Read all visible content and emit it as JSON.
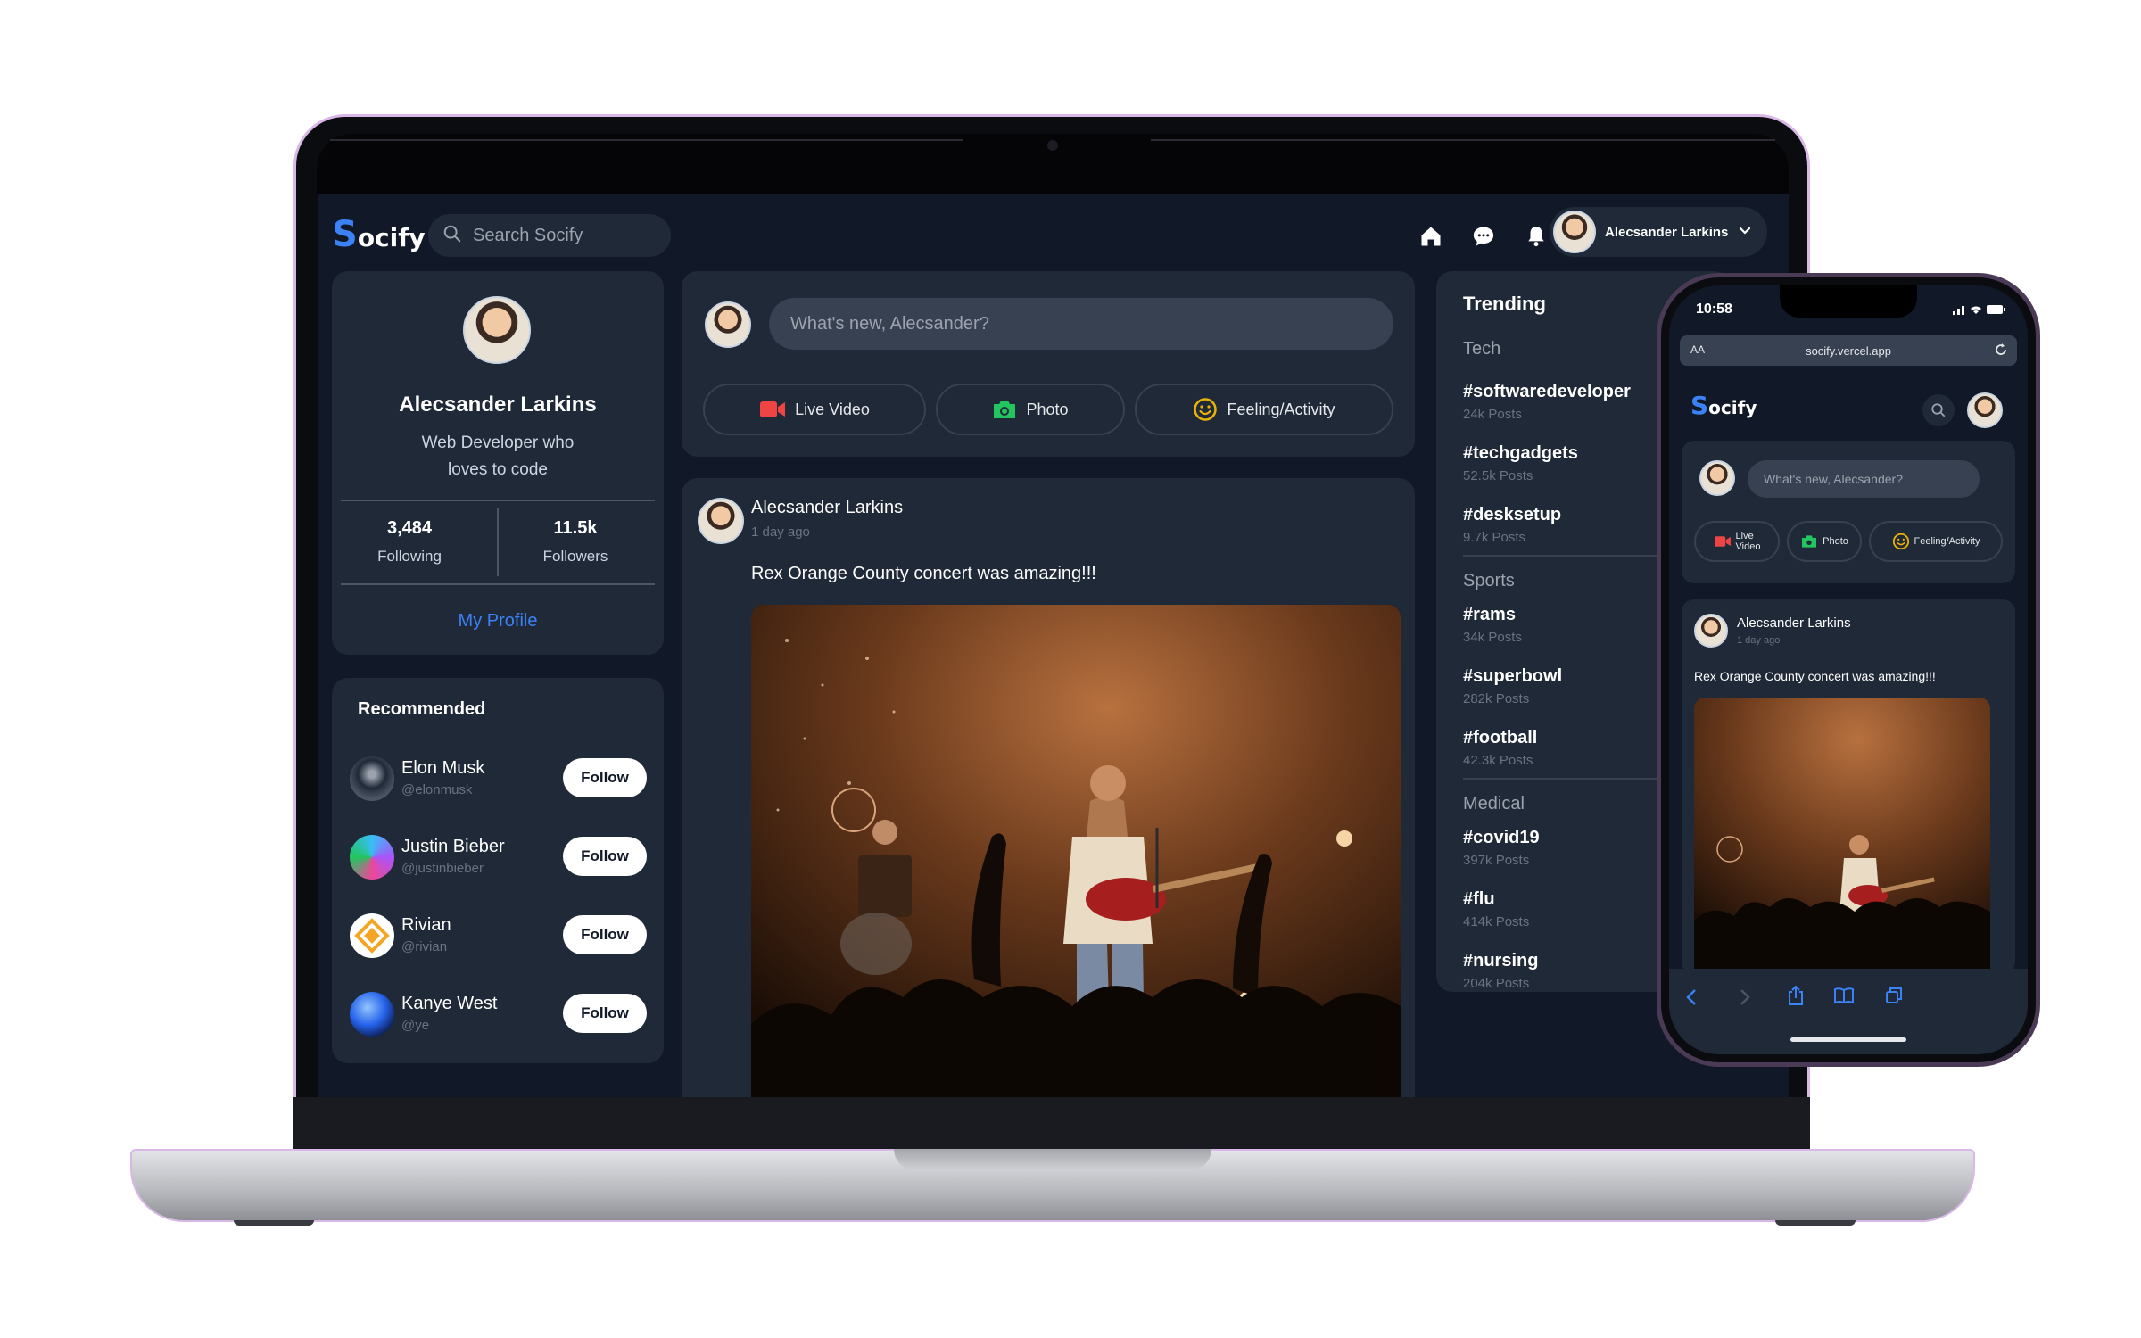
{
  "app": {
    "logo_initial": "S",
    "logo_rest": "ocify",
    "search_placeholder": "Search Socify",
    "user_name": "Alecsander Larkins"
  },
  "profile": {
    "name": "Alecsander Larkins",
    "bio_line1": "Web Developer who",
    "bio_line2": "loves to code",
    "following_count": "3,484",
    "following_label": "Following",
    "followers_count": "11.5k",
    "followers_label": "Followers",
    "my_profile_label": "My Profile"
  },
  "recommended": {
    "title": "Recommended",
    "follow_label": "Follow",
    "items": [
      {
        "name": "Elon Musk",
        "handle": "@elonmusk"
      },
      {
        "name": "Justin Bieber",
        "handle": "@justinbieber"
      },
      {
        "name": "Rivian",
        "handle": "@rivian"
      },
      {
        "name": "Kanye West",
        "handle": "@ye"
      }
    ]
  },
  "composer": {
    "placeholder": "What's new, Alecsander?",
    "live_video_label": "Live Video",
    "photo_label": "Photo",
    "feeling_label": "Feeling/Activity"
  },
  "post": {
    "author": "Alecsander Larkins",
    "time": "1 day ago",
    "text": "Rex Orange County concert was amazing!!!"
  },
  "trending": {
    "title": "Trending",
    "categories": [
      {
        "name": "Tech",
        "tags": [
          {
            "tag": "#softwaredeveloper",
            "posts": "24k Posts"
          },
          {
            "tag": "#techgadgets",
            "posts": "52.5k Posts"
          },
          {
            "tag": "#desksetup",
            "posts": "9.7k Posts"
          }
        ]
      },
      {
        "name": "Sports",
        "tags": [
          {
            "tag": "#rams",
            "posts": "34k Posts"
          },
          {
            "tag": "#superbowl",
            "posts": "282k Posts"
          },
          {
            "tag": "#football",
            "posts": "42.3k Posts"
          }
        ]
      },
      {
        "name": "Medical",
        "tags": [
          {
            "tag": "#covid19",
            "posts": "397k Posts"
          },
          {
            "tag": "#flu",
            "posts": "414k Posts"
          },
          {
            "tag": "#nursing",
            "posts": "204k Posts"
          }
        ]
      }
    ]
  },
  "phone": {
    "status_time": "10:58",
    "text_size_label": "AA",
    "url": "socify.vercel.app",
    "composer_placeholder": "What's new, Alecsander?",
    "live_video_line1": "Live",
    "live_video_line2": "Video",
    "photo_label": "Photo",
    "feeling_label": "Feeling/Activity",
    "post_author": "Alecsander Larkins",
    "post_time": "1 day ago",
    "post_text": "Rex Orange County concert was amazing!!!"
  },
  "colors": {
    "accent": "#3b82f6",
    "background": "#111827",
    "panel": "#1f2937",
    "live_red": "#ef4444",
    "photo_green": "#22c55e",
    "feeling_yellow": "#eab308"
  }
}
